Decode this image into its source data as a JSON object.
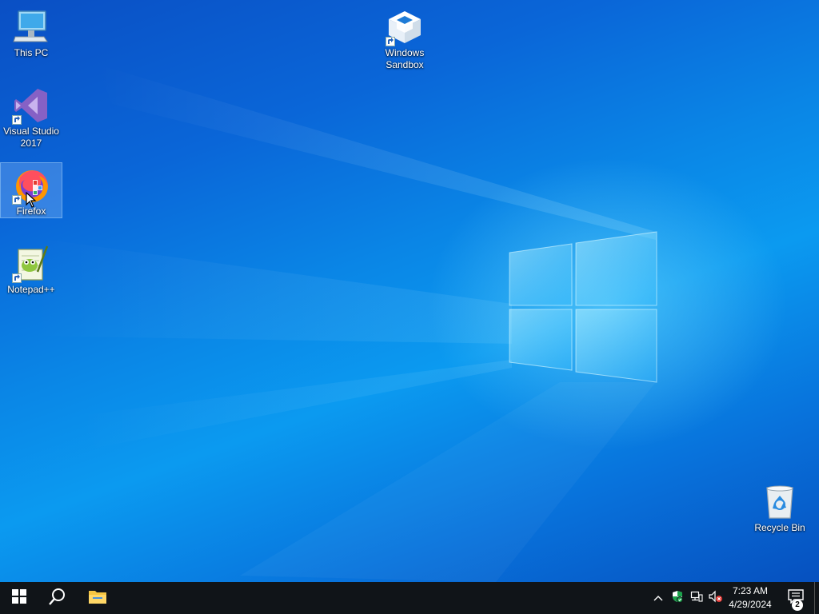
{
  "desktop": {
    "icons": [
      {
        "id": "this-pc",
        "label": "This PC",
        "shortcut": false,
        "selected": false
      },
      {
        "id": "visual-studio",
        "label": "Visual Studio\n2017",
        "shortcut": true,
        "selected": false
      },
      {
        "id": "firefox",
        "label": "Firefox",
        "shortcut": true,
        "selected": true
      },
      {
        "id": "notepadpp",
        "label": "Notepad++",
        "shortcut": true,
        "selected": false
      },
      {
        "id": "windows-sandbox",
        "label": "Windows\nSandbox",
        "shortcut": true,
        "selected": false
      },
      {
        "id": "recycle-bin",
        "label": "Recycle Bin",
        "shortcut": false,
        "selected": false
      }
    ]
  },
  "taskbar": {
    "start": {
      "icon": "windows-logo-icon"
    },
    "search": {
      "icon": "search-icon"
    },
    "pinned": [
      {
        "app": "File Explorer",
        "icon": "folder-icon"
      }
    ],
    "tray": {
      "icons": [
        "chevron-up-icon",
        "security-shield-icon",
        "network-icon",
        "volume-muted-icon"
      ],
      "time": "7:23 AM",
      "date": "4/29/2024",
      "notifications_count": "2"
    }
  },
  "colors": {
    "taskbar": "#101418",
    "desktop_accent": "#0a86e6"
  }
}
